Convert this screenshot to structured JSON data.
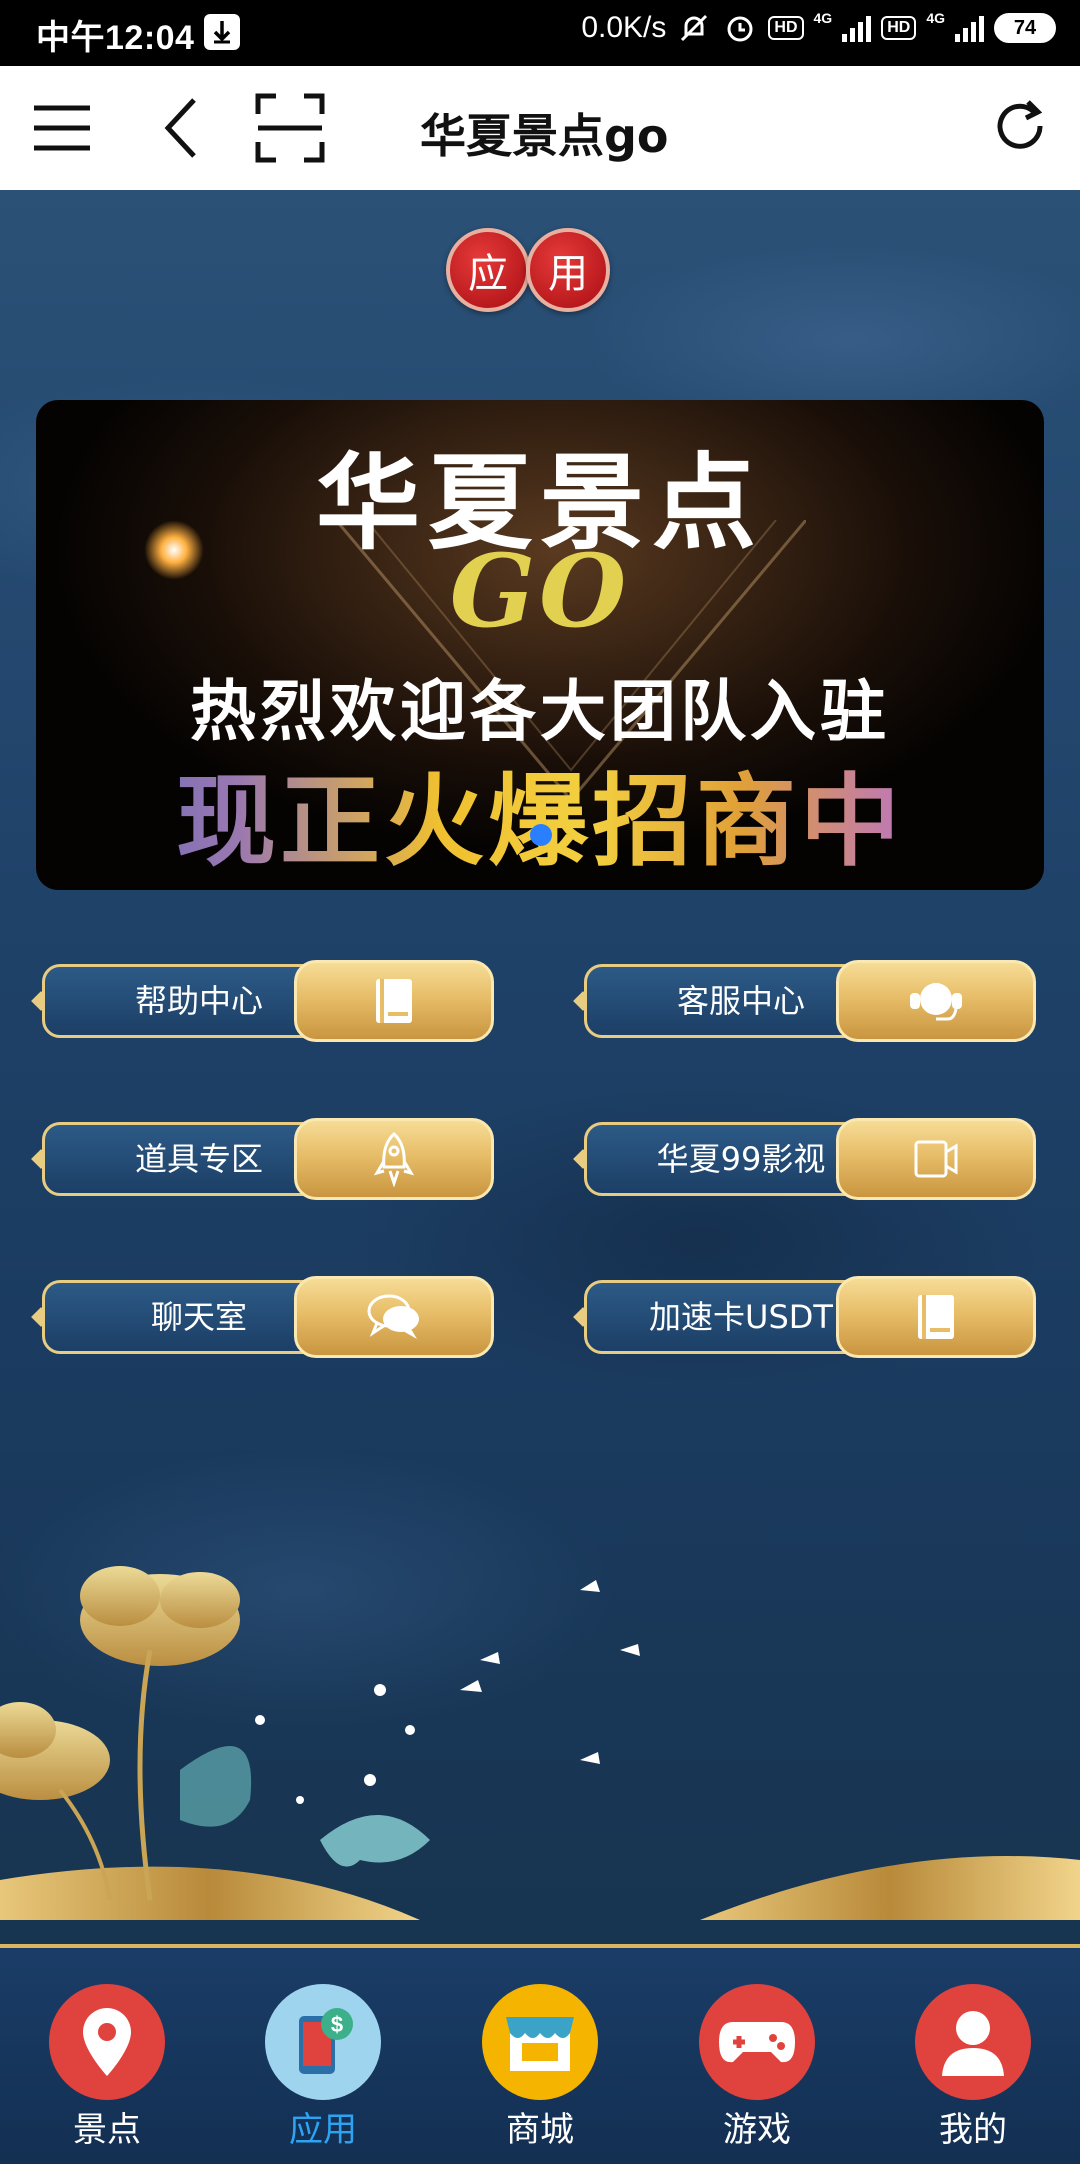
{
  "status_bar": {
    "time": "中午12:04",
    "net_speed": "0.0K/s",
    "hd1": "HD",
    "hd2": "HD",
    "net1": "4G",
    "net2": "4G",
    "battery": "74"
  },
  "header": {
    "title": "华夏景点go"
  },
  "app_tag": [
    "应",
    "用"
  ],
  "banner": {
    "line1": "华夏景点",
    "line2": "GO",
    "line3": "热烈欢迎各大团队入驻",
    "line4": "现正火爆招商中"
  },
  "menu": [
    {
      "label": "帮助中心",
      "icon": "book-icon"
    },
    {
      "label": "客服中心",
      "icon": "headset-icon"
    },
    {
      "label": "道具专区",
      "icon": "rocket-icon"
    },
    {
      "label": "华夏99影视",
      "icon": "video-icon"
    },
    {
      "label": "聊天室",
      "icon": "chat-icon"
    },
    {
      "label": "加速卡USDT",
      "icon": "book-icon"
    }
  ],
  "tabs": [
    {
      "label": "景点",
      "color": "#e0433e",
      "active": false
    },
    {
      "label": "应用",
      "color": "#9fd4ef",
      "active": true
    },
    {
      "label": "商城",
      "color": "#f5b400",
      "active": false
    },
    {
      "label": "游戏",
      "color": "#e0433e",
      "active": false
    },
    {
      "label": "我的",
      "color": "#e0433e",
      "active": false
    }
  ],
  "colors": {
    "active_tab_text": "#2ea3f2",
    "gold": "#e7bd68",
    "background": "#1f4269"
  }
}
